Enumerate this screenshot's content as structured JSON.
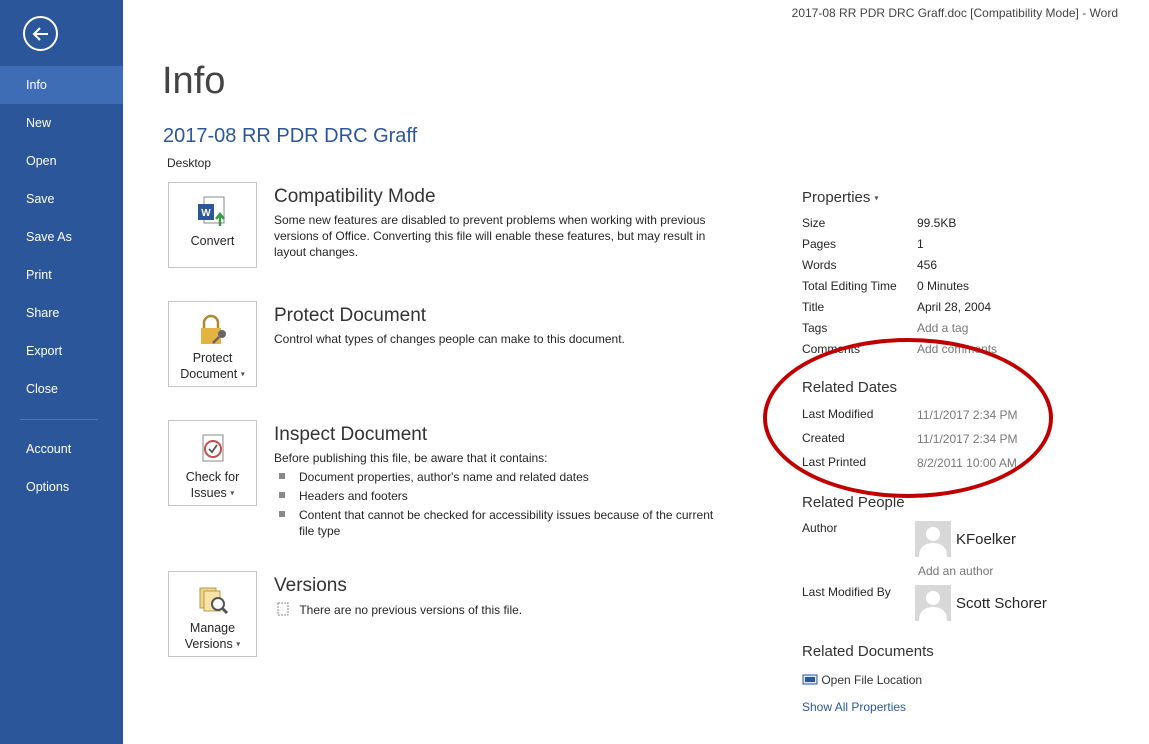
{
  "window": {
    "title": "2017-08 RR PDR DRC Graff.doc [Compatibility Mode] - Word"
  },
  "sidebar": {
    "items": [
      {
        "label": "Info",
        "active": true
      },
      {
        "label": "New"
      },
      {
        "label": "Open"
      },
      {
        "label": "Save"
      },
      {
        "label": "Save As"
      },
      {
        "label": "Print"
      },
      {
        "label": "Share"
      },
      {
        "label": "Export"
      },
      {
        "label": "Close"
      },
      {
        "label": "Account"
      },
      {
        "label": "Options"
      }
    ]
  },
  "main": {
    "title": "Info",
    "doc_name": "2017-08 RR PDR DRC Graff",
    "doc_location": "Desktop",
    "sections": [
      {
        "button_label": "Convert",
        "title": "Compatibility Mode",
        "desc": "Some new features are disabled to prevent problems when working with previous versions of Office. Converting this file will enable these features, but may result in layout changes."
      },
      {
        "button_label_1": "Protect",
        "button_label_2": "Document",
        "title": "Protect Document",
        "desc": "Control what types of changes people can make to this document."
      },
      {
        "button_label_1": "Check for",
        "button_label_2": "Issues",
        "title": "Inspect Document",
        "desc": "Before publishing this file, be aware that it contains:",
        "bullets": [
          "Document properties, author's name and related dates",
          "Headers and footers",
          "Content that cannot be checked for accessibility issues because of the current file type"
        ]
      },
      {
        "button_label_1": "Manage",
        "button_label_2": "Versions",
        "title": "Versions",
        "desc": "There are no previous versions of this file."
      }
    ]
  },
  "properties": {
    "title": "Properties",
    "rows": [
      {
        "label": "Size",
        "value": "99.5KB"
      },
      {
        "label": "Pages",
        "value": "1"
      },
      {
        "label": "Words",
        "value": "456"
      },
      {
        "label": "Total Editing Time",
        "value": "0 Minutes"
      },
      {
        "label": "Title",
        "value": "April 28, 2004"
      },
      {
        "label": "Tags",
        "value": "Add a tag"
      },
      {
        "label": "Comments",
        "value": "Add comments"
      }
    ]
  },
  "related_dates": {
    "title": "Related Dates",
    "rows": [
      {
        "label": "Last Modified",
        "value": "11/1/2017 2:34 PM"
      },
      {
        "label": "Created",
        "value": "11/1/2017 2:34 PM"
      },
      {
        "label": "Last Printed",
        "value": "8/2/2011 10:00 AM"
      }
    ]
  },
  "related_people": {
    "title": "Related People",
    "author_label": "Author",
    "author_name": "KFoelker",
    "add_author": "Add an author",
    "last_modified_by_label": "Last Modified By",
    "last_modified_by_name": "Scott Schorer"
  },
  "related_documents": {
    "title": "Related Documents",
    "open_location": "Open File Location",
    "show_all": "Show All Properties"
  },
  "colors": {
    "accent": "#2b579a",
    "annotation": "#c00000"
  }
}
